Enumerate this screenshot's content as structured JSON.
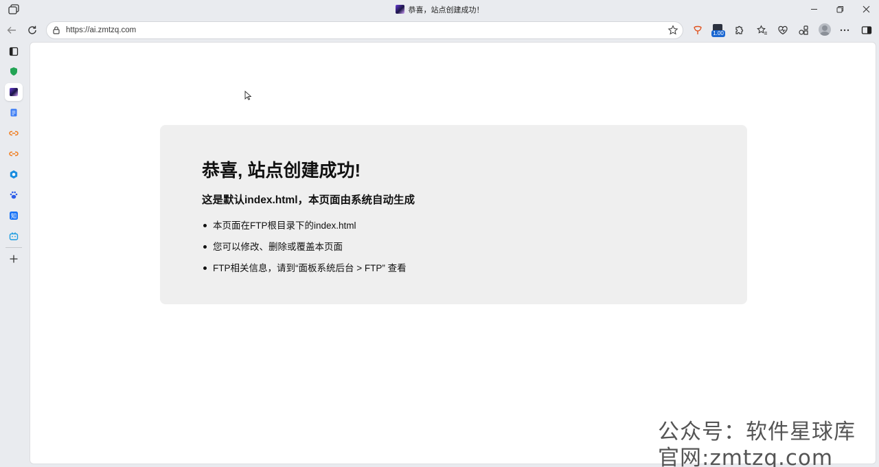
{
  "window": {
    "title": "恭喜，站点创建成功！",
    "favicon": "site-favicon"
  },
  "toolbar": {
    "url": "https://ai.zmtzq.com",
    "extension_badge": "1.00",
    "icons": [
      "back-icon",
      "refresh-icon",
      "lock-icon",
      "favorite-star-icon",
      "extension-icon",
      "puzzle-icon",
      "favorites-icon",
      "health-icon",
      "collections-icon",
      "profile-avatar",
      "more-icon",
      "sidebar-toggle-icon"
    ]
  },
  "sidebar": {
    "items": [
      "tab-actions",
      "shield-extension",
      "current-site",
      "docs-app",
      "link-app-1",
      "link-app-2",
      "hexagon-app",
      "baidu-app",
      "zhihu-app",
      "bilibili-app",
      "add-app"
    ]
  },
  "page": {
    "heading": "恭喜, 站点创建成功!",
    "subheading": "这是默认index.html，本页面由系统自动生成",
    "items": [
      "本页面在FTP根目录下的index.html",
      "您可以修改、删除或覆盖本页面",
      "FTP相关信息，请到“面板系统后台 > FTP” 查看"
    ]
  },
  "watermark": {
    "line1": "公众号：软件星球库",
    "line2": "官网:zmtzq.com"
  },
  "colors": {
    "card_bg": "#efefef",
    "chrome_bg": "#e9ebef",
    "accent": "#1a67d2"
  }
}
